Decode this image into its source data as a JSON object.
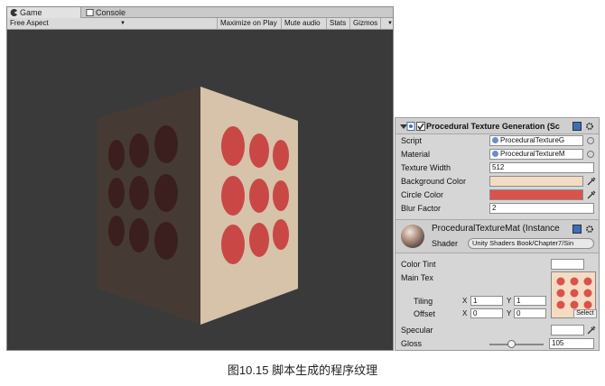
{
  "tabs": {
    "game": "Game",
    "console": "Console"
  },
  "toolbar": {
    "aspect": "Free Aspect",
    "maximize": "Maximize on Play",
    "mute": "Mute audio",
    "stats": "Stats",
    "gizmos": "Gizmos"
  },
  "component": {
    "title": "Procedural Texture Generation (Sc",
    "script_label": "Script",
    "script_value": "ProceduralTextureG",
    "material_label": "Material",
    "material_value": "ProceduralTextureM",
    "texture_width_label": "Texture Width",
    "texture_width_value": "512",
    "background_color_label": "Background Color",
    "background_color": "#f3dcc3",
    "circle_color_label": "Circle Color",
    "circle_color": "#d9534a",
    "blur_factor_label": "Blur Factor",
    "blur_factor_value": "2"
  },
  "material": {
    "name": "ProceduralTextureMat (Instance",
    "shader_label": "Shader",
    "shader_value": "Unity Shaders Book/Chapter7/Sin",
    "color_tint_label": "Color Tint",
    "color_tint": "#ffffff",
    "main_tex_label": "Main Tex",
    "tiling_label": "Tiling",
    "offset_label": "Offset",
    "axis_x": "X",
    "axis_y": "Y",
    "tiling_x": "1",
    "tiling_y": "1",
    "offset_x": "0",
    "offset_y": "0",
    "select_label": "Select",
    "specular_label": "Specular",
    "specular_color": "#ffffff",
    "gloss_label": "Gloss",
    "gloss_value": "105",
    "gloss_fraction": 0.41
  },
  "caption": "图10.15  脚本生成的程序纹理"
}
